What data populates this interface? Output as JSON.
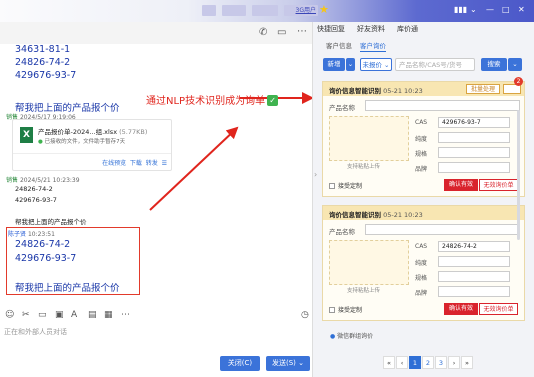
{
  "window": {
    "title_fragment": "3G用户"
  },
  "chat": {
    "truncated_top": "34631-81-1",
    "msg1": {
      "cas": [
        "24826-74-2",
        "429676-93-7"
      ],
      "request": "帮我把上面的产品报个价"
    },
    "file_msg": {
      "sender": "销售",
      "time": "2024/5/17 9:19:06",
      "filename": "产品报价单-2024...组.xlsx",
      "size": "(5.77KB)",
      "status": "已接收的文件，文件助手暂存7天",
      "actions": [
        "在线预览",
        "下载",
        "转发"
      ]
    },
    "msg2": {
      "sender": "销售",
      "time": "2024/5/21 10:23:39",
      "cas": [
        "24826-74-2",
        "429676-93-7"
      ],
      "request": "帮我把上面的产品报个价"
    },
    "msg3": {
      "sender": "陈子贤",
      "time": "10:23:51",
      "cas": [
        "24826-74-2",
        "429676-93-7"
      ],
      "request": "帮我把上面的产品报个价"
    }
  },
  "annotation": {
    "text": "通过NLP技术识别成为询单",
    "check": "✓"
  },
  "input": {
    "placeholder": "正在和外部人员对话"
  },
  "footer": {
    "close_label": "关闭(C)",
    "send_label": "发送(S)"
  },
  "right": {
    "tabs": [
      "快捷回复",
      "好友资料",
      "库价通"
    ],
    "subtabs": [
      "客户信息",
      "客户询价"
    ],
    "filters": {
      "new_label": "新增",
      "quote_label": "未报价",
      "search_placeholder": "产品名称/CAS号/货号",
      "search_label": "搜索"
    },
    "cards": [
      {
        "title": "询价信息智能识别",
        "date": "05-21 10:23",
        "batch_label": "批量处理",
        "badge": "2",
        "product_label": "产品名称",
        "upload_hint": "支持粘贴上传",
        "fields": [
          {
            "label": "CAS",
            "value": "429676-93-7"
          },
          {
            "label": "纯度",
            "value": ""
          },
          {
            "label": "规格",
            "value": ""
          },
          {
            "label": "品牌",
            "value": ""
          }
        ],
        "custom_label": "接受定制",
        "confirm_label": "确认有效",
        "invalid_label": "无效询价单"
      },
      {
        "title": "询价信息智能识别",
        "date": "05-21 10:23",
        "product_label": "产品名称",
        "upload_hint": "支持粘贴上传",
        "fields": [
          {
            "label": "CAS",
            "value": "24826-74-2"
          },
          {
            "label": "纯度",
            "value": ""
          },
          {
            "label": "规格",
            "value": ""
          },
          {
            "label": "品牌",
            "value": ""
          }
        ],
        "custom_label": "接受定制",
        "confirm_label": "确认有效",
        "invalid_label": "无效询价单"
      }
    ],
    "wechat_label": "微信群组询价",
    "pagination": {
      "pages": [
        "1",
        "2",
        "3"
      ],
      "current": "1",
      "prev": "‹",
      "next": "›",
      "first": "«",
      "last": "»"
    }
  },
  "colors": {
    "accent": "#2f6fd6",
    "danger": "#d9232c",
    "annotation": "#e0251d",
    "card_bg": "#fffdf5"
  }
}
